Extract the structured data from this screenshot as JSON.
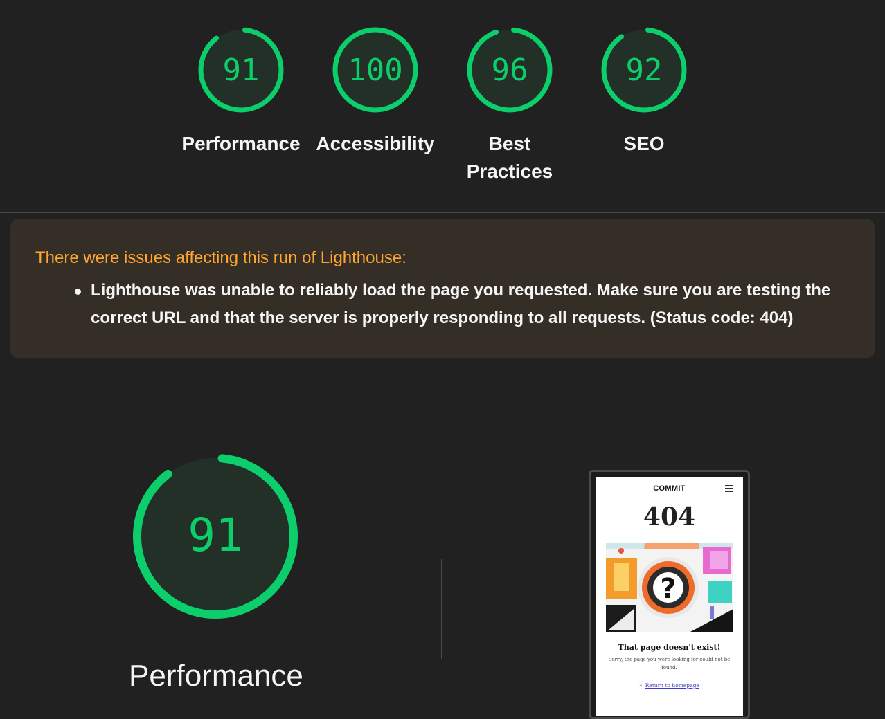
{
  "colors": {
    "pass": "#0cce6b",
    "gauge_fill": "#233028",
    "warning_title": "#ffa531",
    "warning_bg": "#342e27"
  },
  "gauges": [
    {
      "score": "91",
      "label": "Performance",
      "fraction": 0.91
    },
    {
      "score": "100",
      "label": "Accessibility",
      "fraction": 1.0
    },
    {
      "score": "96",
      "label": "Best Practices",
      "label_line1": "Best",
      "label_line2": "Practices",
      "fraction": 0.96
    },
    {
      "score": "92",
      "label": "SEO",
      "fraction": 0.92
    }
  ],
  "warning": {
    "title": "There were issues affecting this run of Lighthouse:",
    "items": [
      {
        "line1": "Lighthouse was unable to reliably load the page you requested. Make sure you are testing the",
        "line2": "correct URL and that the server is properly responding to all requests. (Status code: 404)"
      }
    ]
  },
  "main": {
    "score": "91",
    "label": "Performance",
    "fraction": 0.91
  },
  "screenshot": {
    "logo": "COMMIT",
    "heading": "404",
    "title": "That page doesn't exist!",
    "desc_line1": "Sorry, the page you were looking for could not be",
    "desc_line2": "found.",
    "link": "Return to homepage",
    "menu_icon": "hamburger-menu-icon",
    "chevron_icon": "double-chevron-left-icon"
  }
}
